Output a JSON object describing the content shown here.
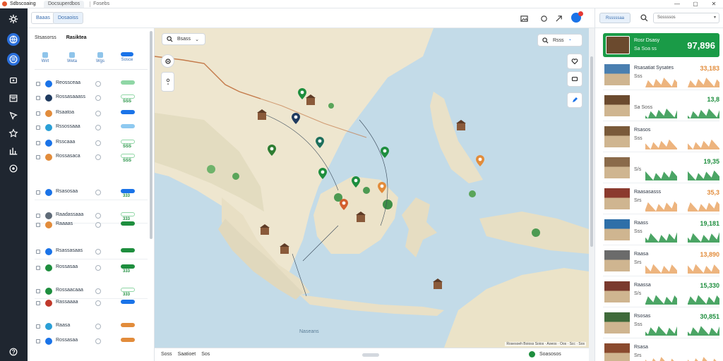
{
  "titlebar": {
    "app_name": "Sdbscoaing",
    "tab_label": "Docsuperdbos",
    "file_label": "Fosebs",
    "controls": [
      "—",
      "▢",
      "✕"
    ]
  },
  "rail": {
    "items": [
      {
        "icon": "settings-icon",
        "active": false
      },
      {
        "icon": "globe-icon",
        "active": true
      },
      {
        "icon": "dashboard-icon",
        "active": true
      },
      {
        "icon": "layers-icon",
        "active": false
      },
      {
        "icon": "calendar-icon",
        "active": false
      },
      {
        "icon": "compass-icon",
        "active": false
      },
      {
        "icon": "star-icon",
        "active": false
      },
      {
        "icon": "bar-chart-icon",
        "active": false
      },
      {
        "icon": "info-icon",
        "active": false
      },
      {
        "icon": "help-icon",
        "active": false
      }
    ]
  },
  "toolbar": {
    "btn1": "Baaas",
    "btn2": "Dosaoiss"
  },
  "listpanel": {
    "tab_a": "Stsasorss",
    "tab_b": "Rasiktea",
    "cols": [
      "Wirt",
      "Weta",
      "Wgs",
      "Sosce"
    ],
    "rows": [
      {
        "name": "Reossceaa",
        "icon_color": "#1a73e8",
        "pill_color": "#8fd6a5",
        "value": "",
        "sep": false
      },
      {
        "name": "Rossasaaass",
        "icon_color": "#1f3a5f",
        "pill_color": "#ffffff",
        "value": "SSS",
        "sep": false
      },
      {
        "name": "Rsaatoa",
        "icon_color": "#e28c3b",
        "pill_color": "#1a73e8",
        "value": "",
        "sep": false
      },
      {
        "name": "Rssossaaa",
        "icon_color": "#2a9fd6",
        "pill_color": "#8ec9f0",
        "value": "",
        "sep": false
      },
      {
        "name": "Rsscaaa",
        "icon_color": "#1a73e8",
        "pill_color": "#ffffff",
        "value": "SSS",
        "sep": false
      },
      {
        "name": "Rossasaca",
        "icon_color": "#e28c3b",
        "pill_color": "#ffffff",
        "value": "SSS",
        "sep": false
      },
      {
        "name": "Rsasosaa",
        "icon_color": "#1a73e8",
        "pill_color": "#1a73e8",
        "value": "333",
        "sep": true
      },
      {
        "name": "Raadassaaa",
        "icon_color": "#5f6b78",
        "pill_color": "#ffffff",
        "value": "333",
        "sep": true
      },
      {
        "name": "Raaaas",
        "icon_color": "#e28c3b",
        "pill_color": "#1e8e3e",
        "value": "",
        "sep": false
      },
      {
        "name": "Rsassasaas",
        "icon_color": "#1a73e8",
        "pill_color": "#1e8e3e",
        "value": "",
        "sep": true
      },
      {
        "name": "Rossasaa",
        "icon_color": "#1e8e3e",
        "pill_color": "#1e8e3e",
        "value": "333",
        "sep": false
      },
      {
        "name": "Rossaacaaa",
        "icon_color": "#1e8e3e",
        "pill_color": "#ffffff",
        "value": "333",
        "sep": true
      },
      {
        "name": "Rassaaaa",
        "icon_color": "#c0392b",
        "pill_color": "#1a73e8",
        "value": "",
        "sep": false
      },
      {
        "name": "Raasa",
        "icon_color": "#2a9fd6",
        "pill_color": "#e28c3b",
        "value": "",
        "sep": false
      },
      {
        "name": "Rossasaa",
        "icon_color": "#1a73e8",
        "pill_color": "#e28c3b",
        "value": "",
        "sep": false
      }
    ]
  },
  "map": {
    "search_label": "Bsass",
    "search_right_label": "Rsss",
    "sea_label": "Naseans",
    "attribution": "Rosesoeh Boioss Soios · Aoeos · Oos · Scc · Sos"
  },
  "statusbar": {
    "left": [
      "Soss",
      "Saatioet",
      "Sos"
    ],
    "right": "Soasosos"
  },
  "rpanel": {
    "btn_label": "Rsssssaa",
    "select_label": "Sossssos",
    "hero": {
      "title": "Rosr Dsasy",
      "subtitle": "Sa Soa ss",
      "value": "97,896"
    },
    "cards": [
      {
        "name": "Rsasatiat Sysates",
        "sub": "Sss",
        "value": "33,183",
        "color": "#e28c3b",
        "spark": "orange"
      },
      {
        "name": "",
        "sub": "Sa Soss",
        "value": "13,8",
        "color": "#1e8e3e",
        "spark": "green"
      },
      {
        "name": "Rsasos",
        "sub": "Sss",
        "value": "",
        "color": "#e28c3b",
        "spark": "orange"
      },
      {
        "name": "",
        "sub": "S/s",
        "value": "19,35",
        "color": "#1e8e3e",
        "spark": "green"
      },
      {
        "name": "Raasasasss",
        "sub": "Srs",
        "value": "35,3",
        "color": "#e28c3b",
        "spark": "orange"
      },
      {
        "name": "Raass",
        "sub": "Sss",
        "value": "19,181",
        "color": "#1e8e3e",
        "spark": "green"
      },
      {
        "name": "Raasa",
        "sub": "Srs",
        "value": "13,890",
        "color": "#e28c3b",
        "spark": "orange"
      },
      {
        "name": "Raassa",
        "sub": "S/s",
        "value": "15,330",
        "color": "#1e8e3e",
        "spark": "green"
      },
      {
        "name": "Rsosas",
        "sub": "Sss",
        "value": "30,851",
        "color": "#1e8e3e",
        "spark": "green"
      },
      {
        "name": "Rsasa",
        "sub": "Srs",
        "value": "",
        "color": "#e28c3b",
        "spark": "orange"
      }
    ]
  },
  "colors": {
    "accent": "#1a73e8",
    "green": "#1e8e3e",
    "orange": "#e28c3b",
    "rail": "#1f2630"
  }
}
